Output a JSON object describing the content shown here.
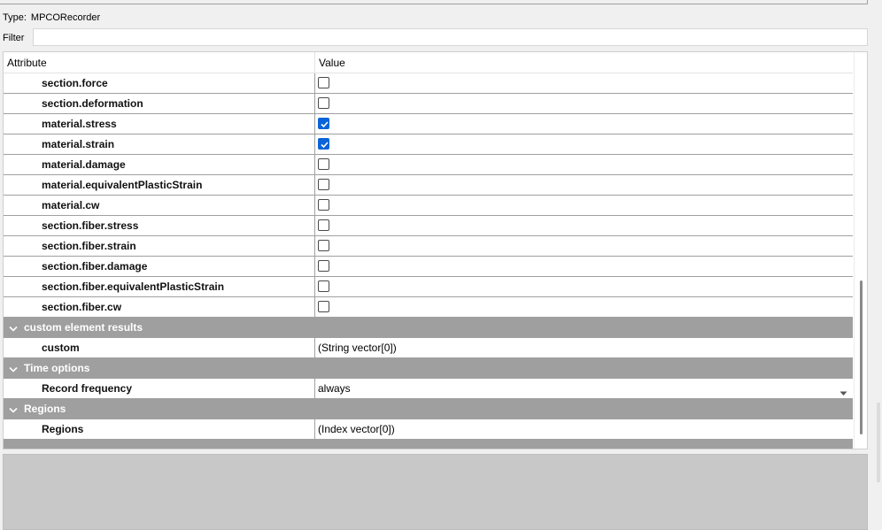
{
  "type_row": {
    "label": "Type:",
    "value": "MPCORecorder"
  },
  "filter": {
    "label": "Filter",
    "value": "",
    "placeholder": ""
  },
  "tree": {
    "header": {
      "attribute": "Attribute",
      "value": "Value"
    },
    "rows": [
      {
        "kind": "checkbox",
        "name": "section.force",
        "checked": false
      },
      {
        "kind": "checkbox",
        "name": "section.deformation",
        "checked": false
      },
      {
        "kind": "checkbox",
        "name": "material.stress",
        "checked": true
      },
      {
        "kind": "checkbox",
        "name": "material.strain",
        "checked": true
      },
      {
        "kind": "checkbox",
        "name": "material.damage",
        "checked": false
      },
      {
        "kind": "checkbox",
        "name": "material.equivalentPlasticStrain",
        "checked": false
      },
      {
        "kind": "checkbox",
        "name": "material.cw",
        "checked": false
      },
      {
        "kind": "checkbox",
        "name": "section.fiber.stress",
        "checked": false
      },
      {
        "kind": "checkbox",
        "name": "section.fiber.strain",
        "checked": false
      },
      {
        "kind": "checkbox",
        "name": "section.fiber.damage",
        "checked": false
      },
      {
        "kind": "checkbox",
        "name": "section.fiber.equivalentPlasticStrain",
        "checked": false
      },
      {
        "kind": "checkbox",
        "name": "section.fiber.cw",
        "checked": false
      },
      {
        "kind": "group",
        "name": "custom element results",
        "icon": "chevron-down-icon"
      },
      {
        "kind": "text",
        "name": "custom",
        "value": "(String vector[0])"
      },
      {
        "kind": "group",
        "name": "Time options",
        "icon": "chevron-down-icon"
      },
      {
        "kind": "dropdown",
        "name": "Record frequency",
        "value": "always",
        "icon": "dropdown-arrow-icon"
      },
      {
        "kind": "group",
        "name": "Regions",
        "icon": "chevron-down-icon"
      },
      {
        "kind": "text",
        "name": "Regions",
        "value": "(Index vector[0])"
      }
    ]
  },
  "colors": {
    "group_background": "#9f9f9f",
    "checkbox_checked": "#0a64d8",
    "grid_line": "#a0a0a0",
    "bottom_panel": "#c8c8c8"
  }
}
